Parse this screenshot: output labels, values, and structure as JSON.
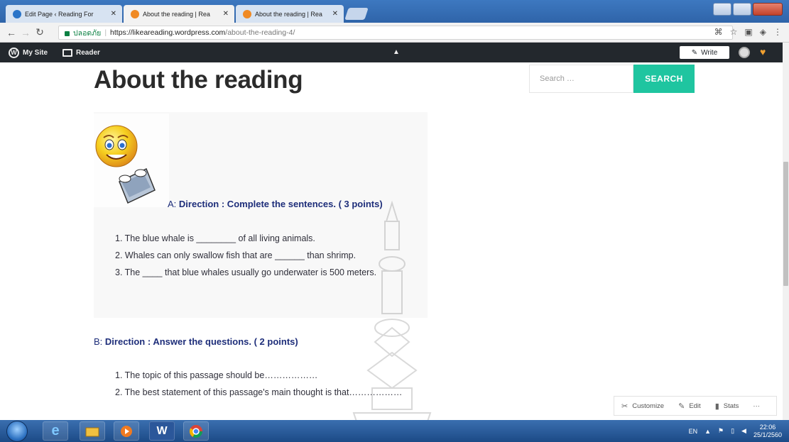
{
  "browser": {
    "tabs": [
      {
        "title": "Edit Page ‹ Reading For",
        "active": false,
        "favicon_color": "#2a74c8"
      },
      {
        "title": "About the reading | Rea",
        "active": true,
        "favicon_color": "#f08a24"
      },
      {
        "title": "About the reading | Rea",
        "active": false,
        "favicon_color": "#f08a24"
      }
    ],
    "secure_label": "ปลอดภัย",
    "url_host": "https://likeareading.wordpress.com",
    "url_path": "/about-the-reading-4/"
  },
  "adminbar": {
    "my_site": "My Site",
    "reader": "Reader",
    "write": "Write"
  },
  "page": {
    "title": "About the reading",
    "search_placeholder": "Search …",
    "search_button": "SEARCH",
    "section_a": {
      "prefix": "A: ",
      "heading": "Direction : Complete the sentences. ( 3 points)",
      "items": [
        "1. The blue whale is ________ of all living animals.",
        "2. Whales can only swallow fish that are ______ than shrimp.",
        "3. The ____ that blue whales usually go underwater is 500 meters."
      ]
    },
    "section_b": {
      "prefix": "B: ",
      "heading": "Direction : Answer the questions. ( 2 points)",
      "items": [
        "1. The topic of this passage should be………………",
        "2. The best statement of this passage's main thought is that………………"
      ]
    }
  },
  "custombar": {
    "customize": "Customize",
    "edit": "Edit",
    "stats": "Stats",
    "more": "···"
  },
  "taskbar": {
    "language": "EN",
    "time": "22:06",
    "date": "25/1/2560"
  },
  "colors": {
    "accent": "#1fc5a0",
    "heading": "#1e2e7a",
    "adminbar": "#23282d"
  }
}
